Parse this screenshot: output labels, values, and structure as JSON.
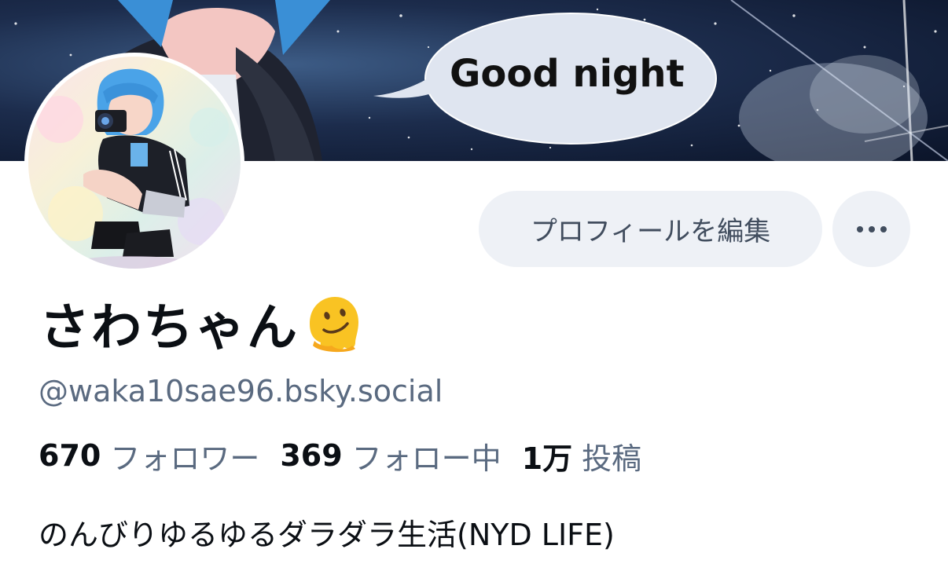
{
  "banner": {
    "speech_bubble_text": "Good night"
  },
  "profile": {
    "display_name": "さわちゃん",
    "name_emoji_icon": "melting-face-icon",
    "handle": "@waka10sae96.bsky.social",
    "bio": "のんびりゆるゆるダラダラ生活(NYD LIFE)"
  },
  "actions": {
    "edit_profile_label": "プロフィールを編集",
    "more_icon": "ellipsis-icon"
  },
  "stats": [
    {
      "value": "670",
      "label": "フォロワー"
    },
    {
      "value": "369",
      "label": "フォロー中"
    },
    {
      "value": "1万",
      "label": "投稿"
    }
  ],
  "colors": {
    "button_bg": "#eef1f6",
    "secondary_text": "#5a6a80",
    "primary_text": "#0b0f14"
  }
}
